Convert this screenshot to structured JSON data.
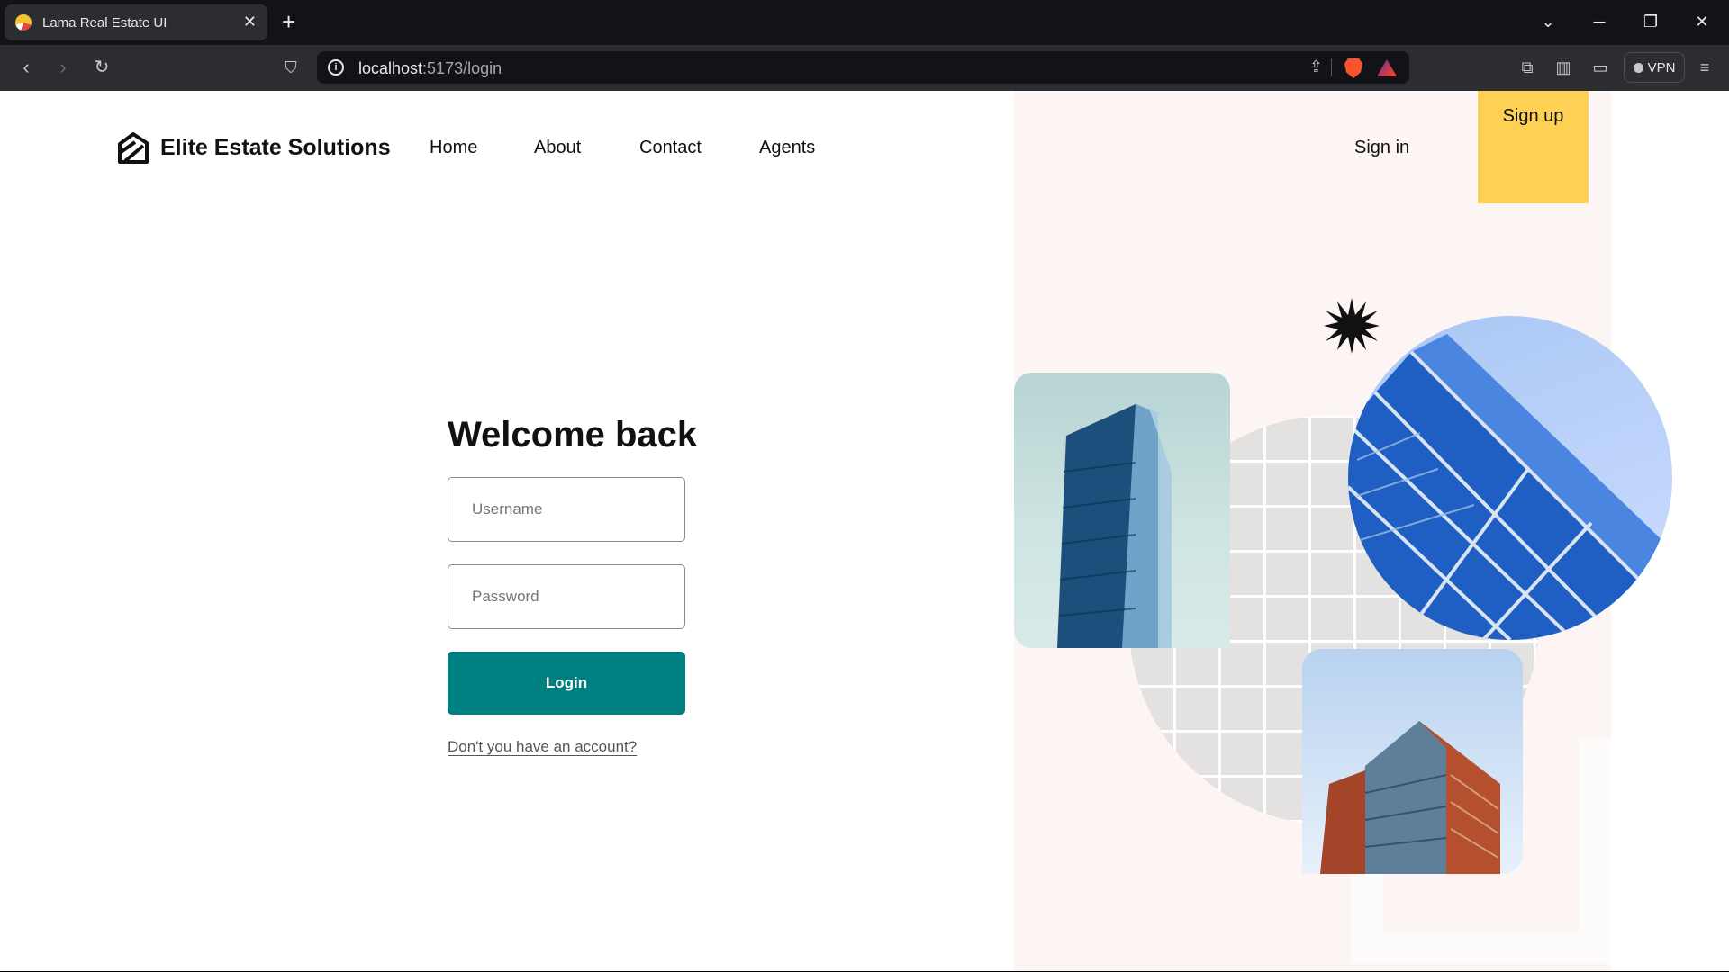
{
  "browser": {
    "tab_title": "Lama Real Estate UI",
    "url_host": "localhost",
    "url_path": ":5173/login",
    "vpn_label": "VPN"
  },
  "header": {
    "brand": "Elite Estate Solutions",
    "nav": [
      "Home",
      "About",
      "Contact",
      "Agents"
    ],
    "sign_in": "Sign in",
    "sign_up": "Sign up"
  },
  "login": {
    "title": "Welcome back",
    "username_placeholder": "Username",
    "password_placeholder": "Password",
    "submit_label": "Login",
    "register_link": "Don't you have an account?"
  },
  "colors": {
    "accent": "#008080",
    "signup_bg": "#fed053",
    "panel_bg": "#fcf5f3"
  }
}
